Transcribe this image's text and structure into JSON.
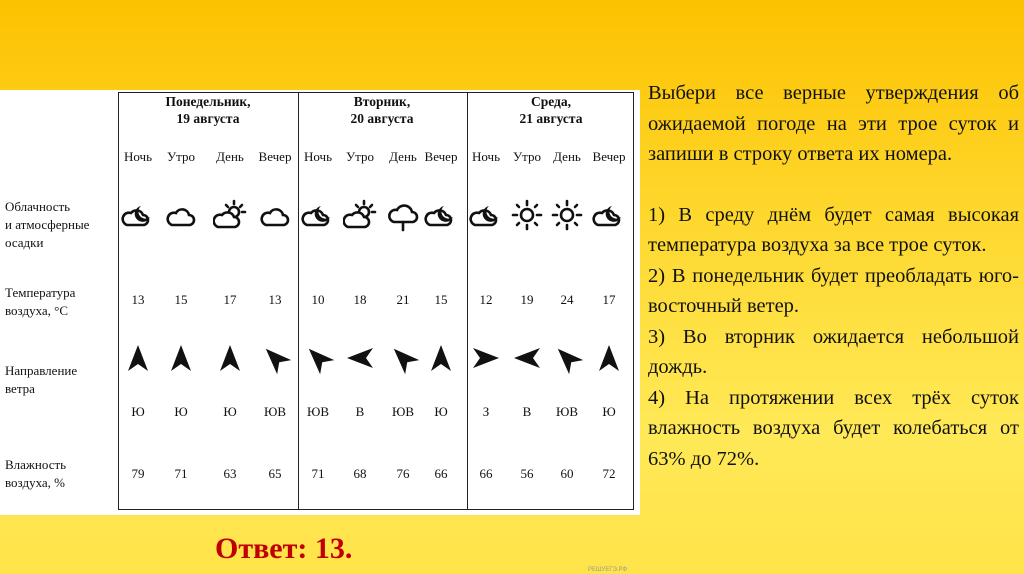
{
  "table": {
    "days": [
      {
        "name": "Понедельник,",
        "date": "19 августа"
      },
      {
        "name": "Вторник,",
        "date": "20 августа"
      },
      {
        "name": "Среда,",
        "date": "21 августа"
      }
    ],
    "periods": [
      "Ночь",
      "Утро",
      "День",
      "Вечер",
      "Ночь",
      "Утро",
      "День",
      "Вечер",
      "Ночь",
      "Утро",
      "День",
      "Вечер"
    ],
    "row_labels": {
      "cloudiness": [
        "Облачность",
        "и атмосферные",
        "осадки"
      ],
      "temperature": [
        "Температура",
        "воздуха, °C"
      ],
      "wind": [
        "Направление",
        "ветра"
      ],
      "humidity": [
        "Влажность",
        "воздуха, %"
      ]
    },
    "cloudiness_icons": [
      "moon-cloud",
      "cloud",
      "sun-cloud",
      "cloud",
      "moon-cloud",
      "sun-cloud",
      "rain-cloud",
      "moon-cloud",
      "moon-cloud",
      "sun",
      "sun",
      "moon-cloud"
    ],
    "temperature": [
      "13",
      "15",
      "17",
      "13",
      "10",
      "18",
      "21",
      "15",
      "12",
      "19",
      "24",
      "17"
    ],
    "wind_direction": [
      "Ю",
      "Ю",
      "Ю",
      "ЮВ",
      "ЮВ",
      "В",
      "ЮВ",
      "Ю",
      "З",
      "В",
      "ЮВ",
      "Ю"
    ],
    "humidity": [
      "79",
      "71",
      "63",
      "65",
      "71",
      "68",
      "76",
      "66",
      "66",
      "56",
      "60",
      "72"
    ],
    "watermark": "РЕШУЕГЭ.РФ"
  },
  "question": {
    "intro": "Выбери все верные утверждения об ожидаемой погоде на эти трое суток и запиши в строку ответа их номера.",
    "options": [
      "1) В среду днём будет самая высокая температура воздуха за все трое суток.",
      "2) В понедельник будет преобладать юго-восточный ветер.",
      "3) Во вторник ожидается небольшой дождь.",
      "4) На протяжении всех трёх суток влажность воздуха будет колебаться от 63% до 72%."
    ]
  },
  "answer": "Ответ: 13.",
  "colors": {
    "answer": "#c00000",
    "background": "#fed62a"
  }
}
